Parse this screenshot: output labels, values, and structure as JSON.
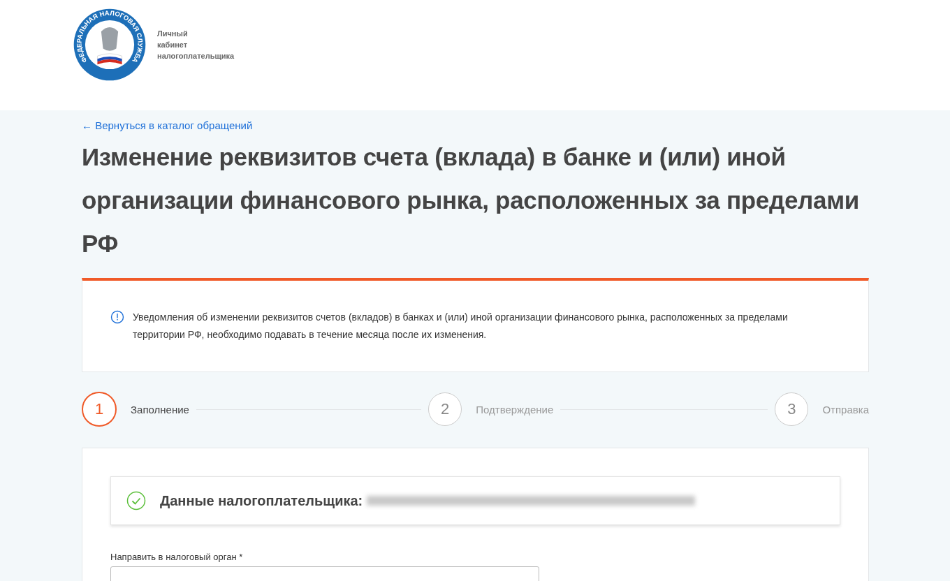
{
  "header": {
    "emblem_text": "ФЕДЕРАЛЬНАЯ НАЛОГОВАЯ СЛУЖБА",
    "site_title_lines": [
      "Личный",
      "кабинет",
      "налогоплательщика"
    ]
  },
  "back_link": "← Вернуться в каталог обращений",
  "page_title": "Изменение реквизитов счета (вклада) в банке и (или) иной организации финансового рынка, расположенных за пределами РФ",
  "notice": {
    "text": "Уведомления об изменении реквизитов счетов (вкладов) в банках и (или) иной организации финансового рынка, расположенных за пределами территории РФ, необходимо подавать в течение месяца после их изменения."
  },
  "steps": [
    {
      "number": "1",
      "label": "Заполнение",
      "selected": true
    },
    {
      "number": "2",
      "label": "Подтверждение",
      "selected": false
    },
    {
      "number": "3",
      "label": "Отправка",
      "selected": false
    }
  ],
  "taxpayer": {
    "label": "Данные налогоплательщика:",
    "checked": true
  },
  "form": {
    "tax_authority_label": "Направить в налоговый орган *"
  }
}
